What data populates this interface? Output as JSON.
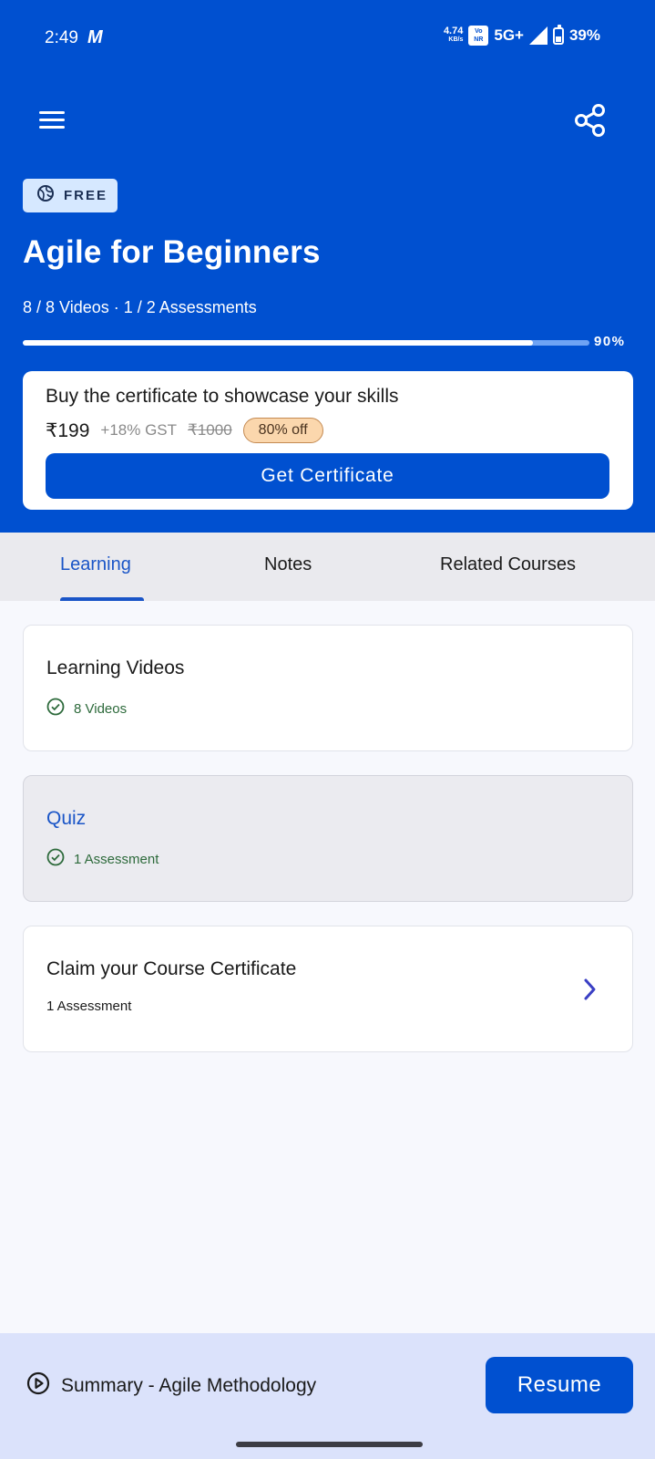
{
  "status_bar": {
    "time": "2:49",
    "carrier_glyph": "M",
    "net_speed_value": "4.74",
    "net_speed_unit": "KB/s",
    "volte_top": "Vo",
    "volte_bottom": "NR",
    "network": "5G+",
    "battery": "39%"
  },
  "header": {
    "menu_icon": "hamburger-menu-icon",
    "share_icon": "share-icon",
    "badge_label": "FREE",
    "title": "Agile for Beginners",
    "meta": "8 / 8 Videos · 1 / 2 Assessments",
    "progress_percent": 90,
    "progress_label": "90%"
  },
  "certificate_card": {
    "headline": "Buy the certificate to showcase your skills",
    "price": "₹199",
    "gst": "+18% GST",
    "old_price": "₹1000",
    "discount": "80% off",
    "button_label": "Get Certificate"
  },
  "tabs": [
    {
      "label": "Learning",
      "active": true
    },
    {
      "label": "Notes",
      "active": false
    },
    {
      "label": "Related Courses",
      "active": false
    }
  ],
  "sections": [
    {
      "title": "Learning Videos",
      "subtitle": "8 Videos",
      "completed": true
    },
    {
      "title": "Quiz",
      "subtitle": "1 Assessment",
      "completed": true
    },
    {
      "title": "Claim your Course Certificate",
      "subtitle": "1 Assessment",
      "completed": false
    }
  ],
  "bottom_bar": {
    "summary_label": "Summary - Agile Methodology",
    "resume_label": "Resume"
  },
  "colors": {
    "primary": "#0050d0",
    "accent_text": "#1a55c7",
    "success": "#2d6a3b",
    "discount_bg": "#fbd7ad"
  }
}
